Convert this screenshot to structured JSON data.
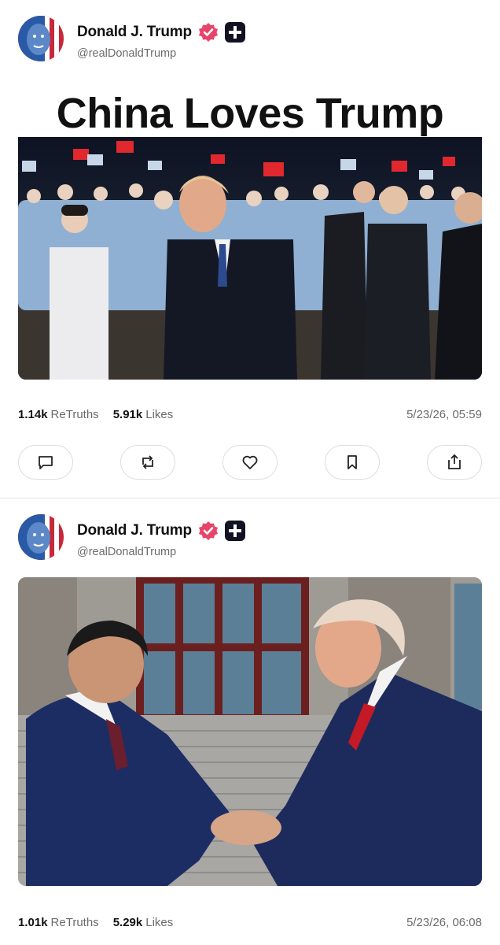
{
  "posts": [
    {
      "author": {
        "name": "Donald J. Trump",
        "handle": "@realDonaldTrump"
      },
      "image_headline": "China Loves Trump",
      "stats": {
        "retruths_count": "1.14k",
        "retruths_label": "ReTruths",
        "likes_count": "5.91k",
        "likes_label": "Likes"
      },
      "timestamp": "5/23/26, 05:59",
      "actions": [
        "comment-icon",
        "retruth-icon",
        "heart-icon",
        "bookmark-icon",
        "share-icon"
      ]
    },
    {
      "author": {
        "name": "Donald J. Trump",
        "handle": "@realDonaldTrump"
      },
      "stats": {
        "retruths_count": "1.01k",
        "retruths_label": "ReTruths",
        "likes_count": "5.29k",
        "likes_label": "Likes"
      },
      "timestamp": "5/23/26, 06:08"
    }
  ],
  "colors": {
    "verified_badge": "#e8446a",
    "plus_badge": "#121222",
    "muted_text": "#6b6b6b"
  }
}
